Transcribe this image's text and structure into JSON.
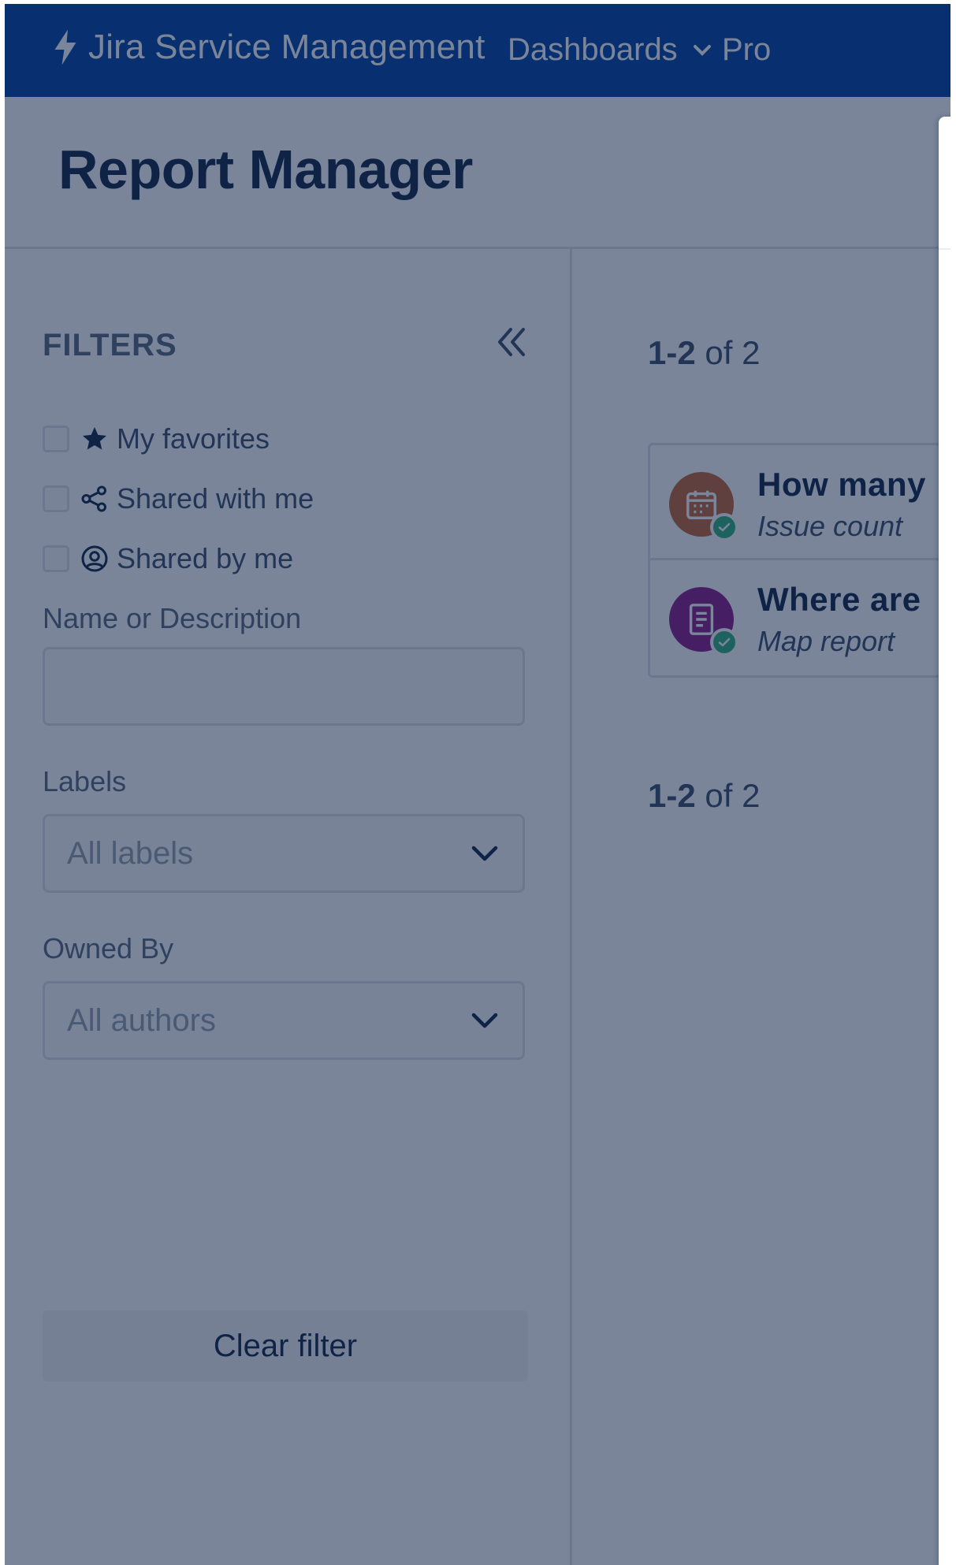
{
  "nav": {
    "brand": "Jira Service Management",
    "items": [
      {
        "label": "Dashboards"
      },
      {
        "label": "Pro"
      }
    ]
  },
  "page": {
    "title": "Report Manager"
  },
  "filters": {
    "title": "FILTERS",
    "checks": [
      {
        "label": "My favorites",
        "icon": "star-icon"
      },
      {
        "label": "Shared with me",
        "icon": "share-icon"
      },
      {
        "label": "Shared by me",
        "icon": "user-circle-icon"
      }
    ],
    "name_label": "Name or Description",
    "name_value": "",
    "labels_label": "Labels",
    "labels_value": "All labels",
    "owned_label": "Owned By",
    "owned_value": "All authors",
    "clear_label": "Clear filter"
  },
  "results": {
    "pager_range": "1-2",
    "pager_of": "of 2",
    "reports": [
      {
        "name": "How many",
        "type": "Issue count",
        "color": "#c46a3c",
        "icon": "calendar-icon"
      },
      {
        "name": "Where are",
        "type": "Map report",
        "color": "#8e1f8a",
        "icon": "document-icon"
      }
    ]
  },
  "colors": {
    "nav": "#0747a6",
    "overlay": "rgba(9,30,66,0.54)",
    "success": "#36b37e"
  }
}
